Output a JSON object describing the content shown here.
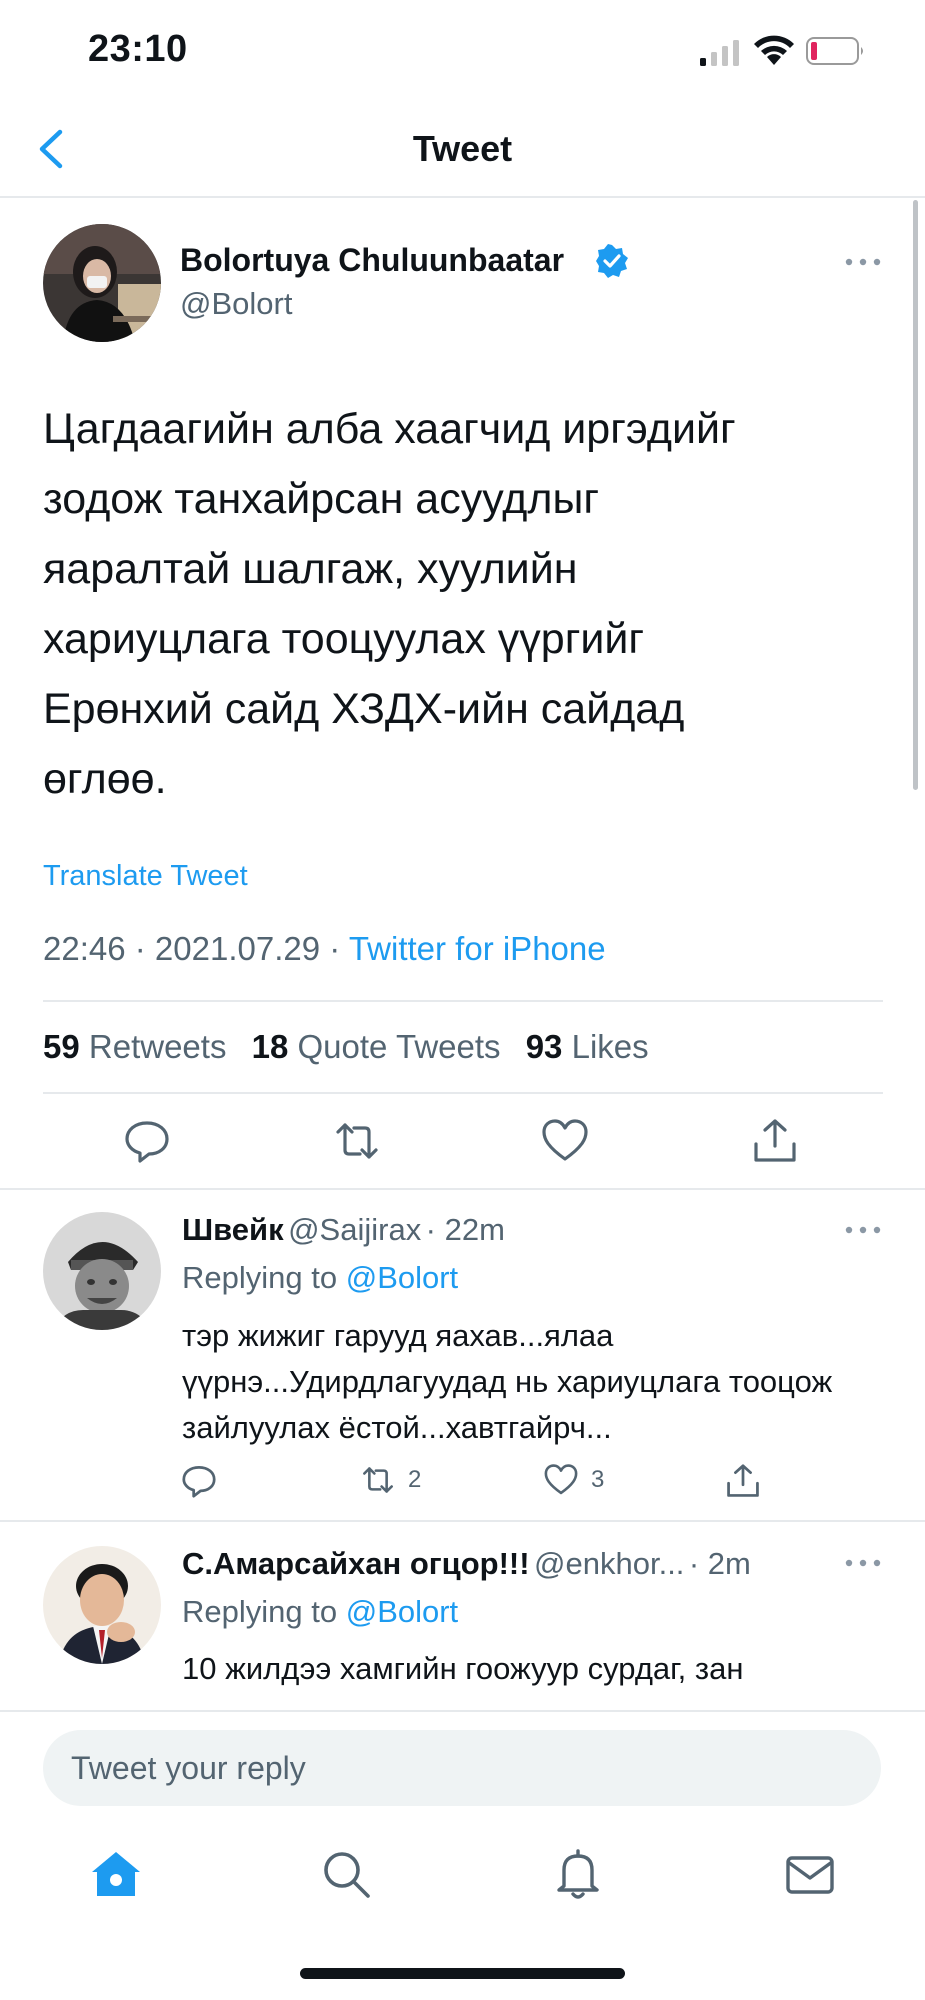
{
  "status_bar": {
    "time": "23:10",
    "icons": [
      "cellular-signal-icon",
      "wifi-icon",
      "battery-low-icon"
    ]
  },
  "header": {
    "back_icon": "chevron-left-icon",
    "title": "Tweet"
  },
  "tweet": {
    "author_name": "Bolortuya Chuluunbaatar",
    "author_handle": "@Bolort",
    "verified": true,
    "text": "Цагдаагийн алба хаагчид иргэдийг\nзодож танхайрсан асуудлыг\nяаралтай шалгаж, хуулийн\nхариуцлага тооцуулах үүргийг\nЕрөнхий сайд ХЗДХ-ийн сайдад\nөглөө.",
    "translate_label": "Translate Tweet",
    "time": "22:46",
    "date": "2021.07.29",
    "source": "Twitter for iPhone",
    "stats": {
      "retweets_count": "59",
      "retweets_label": "Retweets",
      "quotes_count": "18",
      "quotes_label": "Quote Tweets",
      "likes_count": "93",
      "likes_label": "Likes"
    }
  },
  "replies": [
    {
      "name": "Швейк",
      "handle": "@Saijirax",
      "age": "· 22m",
      "replying_prefix": "Replying to",
      "replying_to": "@Bolort",
      "text": "тэр жижиг гарууд яахав...ялаа үүрнэ...Удирдлагуудад нь хариуцлага тооцож зайлуулах ёстой...хавтгайрч...",
      "retweet_count": "2",
      "like_count": "3"
    },
    {
      "name": "С.Амарсайхан огцор!!!",
      "handle": "@enkhor...",
      "age": "· 2m",
      "replying_prefix": "Replying to",
      "replying_to": "@Bolort",
      "text": "10 жилдээ хамгийн гоожуур сурдаг, зан"
    }
  ],
  "reply_bar": {
    "placeholder": "Tweet your reply"
  },
  "tab_bar": [
    "home-icon",
    "search-icon",
    "notifications-bell-icon",
    "messages-envelope-icon"
  ],
  "colors": {
    "accent": "#1d9bf0",
    "text": "#0f1419",
    "secondary": "#536471"
  }
}
